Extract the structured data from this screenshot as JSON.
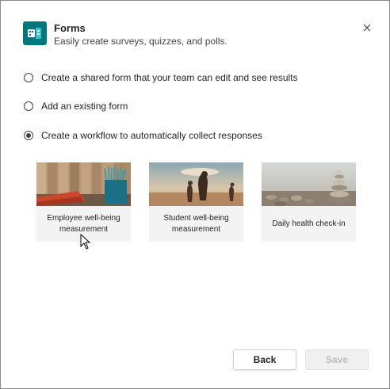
{
  "header": {
    "title": "Forms",
    "subtitle": "Easily create surveys, quizzes, and polls.",
    "app_icon": "forms-app-icon",
    "close_icon": "close-icon"
  },
  "options": [
    {
      "label": "Create a shared form that your team can edit and see results",
      "selected": false
    },
    {
      "label": "Add an existing form",
      "selected": false
    },
    {
      "label": "Create a workflow to automatically collect responses",
      "selected": true
    }
  ],
  "templates": [
    {
      "label": "Employee well-being measurement",
      "image": "desk-pencils-image"
    },
    {
      "label": "Student well-being measurement",
      "image": "beach-surfers-image"
    },
    {
      "label": "Daily health check-in",
      "image": "stacked-stones-image"
    }
  ],
  "footer": {
    "back_label": "Back",
    "save_label": "Save",
    "save_disabled": true
  },
  "colors": {
    "app_icon_bg": "#03787c",
    "save_disabled_text": "#bdbdbd"
  }
}
